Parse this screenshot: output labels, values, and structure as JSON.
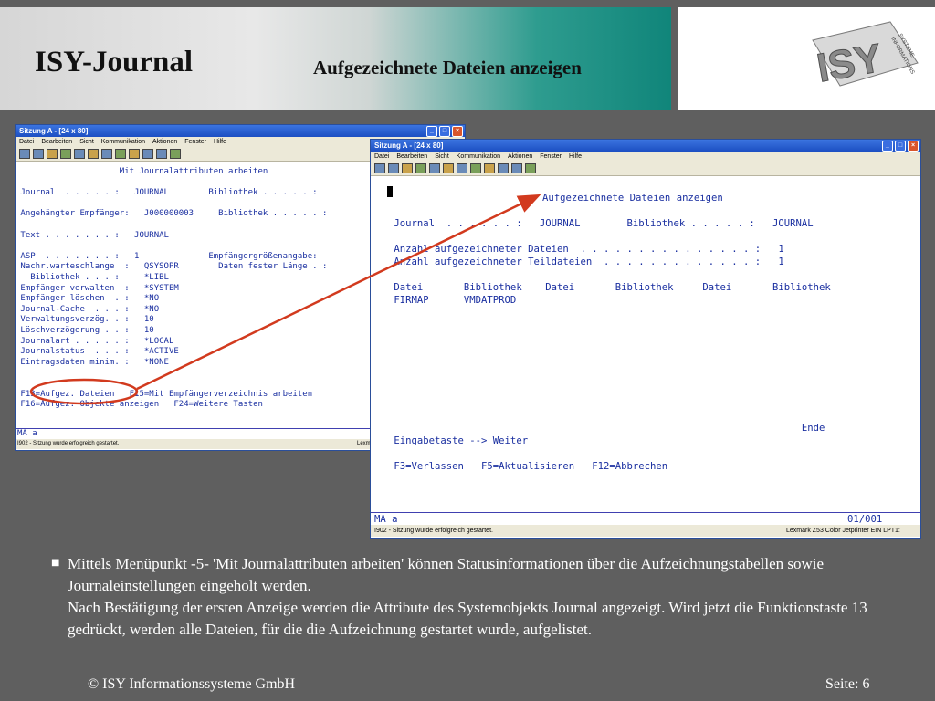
{
  "slide": {
    "title": "ISY-Journal",
    "subtitle": "Aufgezeichnete Dateien anzeigen",
    "logo_text": "ISY",
    "logo_side_text": "INFORMATIONS SYSTEME",
    "bullet": "Mittels Menüpunkt -5- 'Mit Journalattributen arbeiten' können Statusinformationen über die Aufzeichnungstabellen sowie Journaleinstellungen eingeholt werden.",
    "bullet_2": "Nach Bestätigung der ersten Anzeige werden die Attribute des Systemobjekts Journal angezeigt. Wird jetzt die Funktionstaste 13 gedrückt, werden alle Dateien, für die die Aufzeichnung gestartet wurde, aufgelistet.",
    "footer_left": "© ISY Informationssysteme GmbH",
    "footer_right": "Seite: 6",
    "accent_red": "#d23a1e",
    "terminal_blue": "#1a2fa0"
  },
  "window1": {
    "title": "Sitzung A - [24 x 80]",
    "menu": [
      "Datei",
      "Bearbeiten",
      "Sicht",
      "Kommunikation",
      "Aktionen",
      "Fenster",
      "Hilfe"
    ],
    "lines": [
      "                     Mit Journalattributen arbeiten",
      "",
      " Journal  . . . . . :   JOURNAL        Bibliothek . . . . . :",
      "",
      " Angehängter Empfänger:   J000000003     Bibliothek . . . . . :",
      "",
      " Text . . . . . . . :   JOURNAL",
      "",
      " ASP  . . . . . . . :   1              Empfängergrößenangabe:",
      " Nachr.warteschlange  :   QSYSOPR        Daten fester Länge . :",
      "   Bibliothek . . . :     *LIBL",
      " Empfänger verwalten  :   *SYSTEM",
      " Empfänger löschen  . :   *NO",
      " Journal-Cache  . . . :   *NO",
      " Verwaltungsverzög. . :   10",
      " Löschverzögerung . . :   10",
      " Journalart . . . . . :   *LOCAL",
      " Journalstatus  . . . :   *ACTIVE",
      " Eintragsdaten minim. :   *NONE",
      "",
      "",
      " F13=Aufgez. Dateien   F15=Mit Empfängerverzeichnis arbeiten",
      " F16=Aufgez. Objekte anzeigen   F24=Weitere Tasten"
    ],
    "cmd": "MA      a",
    "status": "I902 - Sitzung wurde erfolgreich gestartet.",
    "status_right": "Lexmark"
  },
  "window2": {
    "title": "Sitzung A - [24 x 80]",
    "menu": [
      "Datei",
      "Bearbeiten",
      "Sicht",
      "Kommunikation",
      "Aktionen",
      "Fenster",
      "Hilfe"
    ],
    "heading": "Aufgezeichnete Dateien anzeigen",
    "lines": [
      "",
      "",
      " Journal  . . . . . . :   JOURNAL        Bibliothek . . . . . :   JOURNAL",
      "",
      " Anzahl aufgezeichneter Dateien  . . . . . . . . . . . . . . . :   1",
      " Anzahl aufgezeichneter Teildateien  . . . . . . . . . . . . . :   1",
      "",
      " Datei       Bibliothek    Datei       Bibliothek     Datei       Bibliothek",
      " FIRMAP      VMDATPROD",
      "",
      "",
      "",
      "",
      "",
      "",
      "",
      "",
      "",
      "                                                                       Ende",
      " Eingabetaste --> Weiter",
      "",
      " F3=Verlassen   F5=Aktualisieren   F12=Abbrechen"
    ],
    "cmd": "MA      a",
    "cmd_right": "01/001",
    "status": "I902 - Sitzung wurde erfolgreich gestartet.",
    "status_right": "Lexmark Z53 Color Jetprinter EIN LPT1:"
  }
}
